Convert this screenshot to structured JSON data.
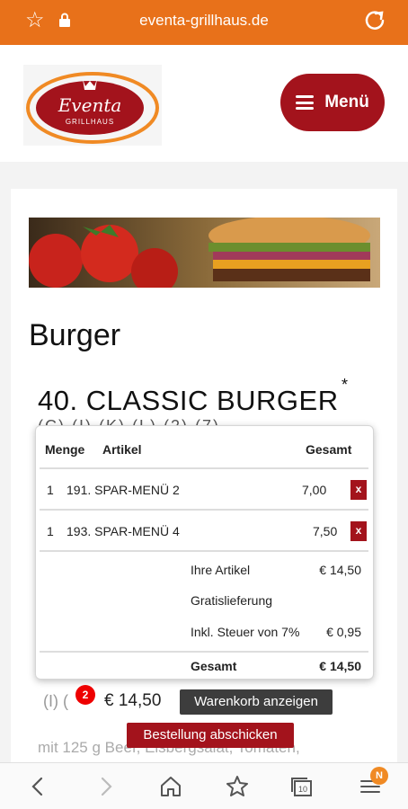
{
  "browser": {
    "url": "eventa-grillhaus.de",
    "star_icon": "star-outline-icon",
    "lock_icon": "lock-icon",
    "reload_icon": "reload-icon",
    "accent": "#e8711a"
  },
  "header": {
    "logo_text": "Eventa",
    "logo_subtext": "GRILLHAUS",
    "menu_label": "Menü",
    "brand_color": "#a3131c"
  },
  "content": {
    "category_title": "Burger",
    "product_title": "40. CLASSIC BURGER",
    "product_star": "*",
    "allergens": "(C) (I) (K) (L) (2) (7)",
    "description_partial": "mit 125 g Beef, Eisbergsalat, Tomaten,",
    "left_fragment": "(I) ("
  },
  "cart": {
    "headers": {
      "qty": "Menge",
      "item": "Artikel",
      "total": "Gesamt"
    },
    "items": [
      {
        "qty": "1",
        "name": "191. SPAR-MENÜ 2",
        "price": "7,00",
        "remove": "x"
      },
      {
        "qty": "1",
        "name": "193. SPAR-MENÜ 4",
        "price": "7,50",
        "remove": "x"
      }
    ],
    "summary": {
      "items_label": "Ihre Artikel",
      "items_value": "€ 14,50",
      "delivery_label": "Gratislieferung",
      "tax_label": "Inkl. Steuer von 7%",
      "tax_value": "€ 0,95",
      "total_label": "Gesamt",
      "total_value": "€ 14,50"
    }
  },
  "cartbar": {
    "badge_count": "2",
    "total": "€ 14,50",
    "show_cart_label": "Warenkorb anzeigen",
    "submit_label": "Bestellung abschicken"
  },
  "bottomnav": {
    "icons": [
      "back-icon",
      "forward-icon",
      "home-icon",
      "bookmarks-star-icon",
      "tabs-icon",
      "menu-icon"
    ],
    "tabs_count": "10",
    "menu_badge": "N"
  }
}
